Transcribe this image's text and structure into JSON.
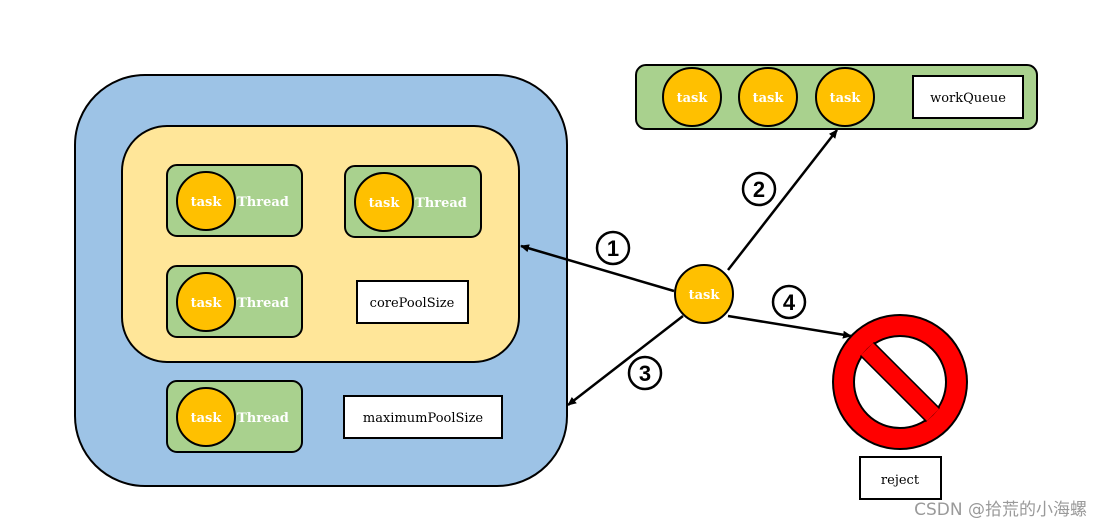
{
  "colors": {
    "pool": "#9DC3E6",
    "core": "#FFE699",
    "thread": "#A9D18E",
    "task": "#FFC000",
    "reject": "#FF0000"
  },
  "task_label": "task",
  "thread_label": "Thread",
  "core_pool_label": "corePoolSize",
  "max_pool_label": "maximumPoolSize",
  "work_queue_label": "workQueue",
  "reject_label": "reject",
  "steps": [
    "1",
    "2",
    "3",
    "4"
  ],
  "watermark": "CSDN @拾荒的小海螺",
  "icons": {
    "reject": "prohibited-sign-icon"
  }
}
